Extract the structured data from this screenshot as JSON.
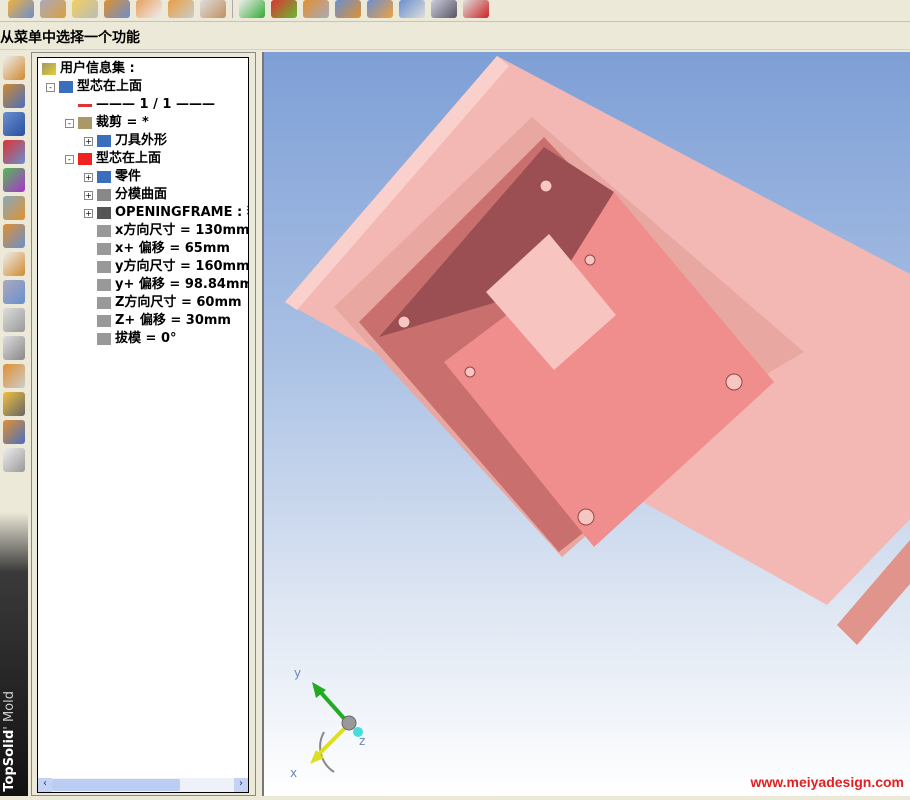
{
  "prompt": "从菜单中选择一个功能",
  "brand": {
    "name": "TopSolid",
    "suffix": "' Mold"
  },
  "tree": {
    "root": "用户信息集 :",
    "items": [
      {
        "label": "型芯在上面",
        "level": 1,
        "expander": "-"
      },
      {
        "label": "——— 1 / 1 ———",
        "level": 2,
        "expander": ""
      },
      {
        "label": "裁剪 = *",
        "level": 2,
        "expander": "-"
      },
      {
        "label": "刀具外形",
        "level": 3,
        "expander": "+"
      },
      {
        "label": "型芯在上面",
        "level": 2,
        "expander": "-"
      },
      {
        "label": "零件",
        "level": 3,
        "expander": "+"
      },
      {
        "label": "分模曲面",
        "level": 3,
        "expander": "+"
      },
      {
        "label": "OPENINGFRAME : 套",
        "level": 3,
        "expander": "+"
      },
      {
        "label": "x方向尺寸 = 130mm",
        "level": 3,
        "expander": ""
      },
      {
        "label": "x+ 偏移 = 65mm",
        "level": 3,
        "expander": ""
      },
      {
        "label": "y方向尺寸 = 160mm",
        "level": 3,
        "expander": ""
      },
      {
        "label": "y+ 偏移 = 98.84mm",
        "level": 3,
        "expander": ""
      },
      {
        "label": "Z方向尺寸 = 60mm",
        "level": 3,
        "expander": ""
      },
      {
        "label": "Z+ 偏移 = 30mm",
        "level": 3,
        "expander": ""
      },
      {
        "label": "拔模 = 0°",
        "level": 3,
        "expander": ""
      }
    ]
  },
  "axes": {
    "x": "x",
    "y": "y",
    "z": "z"
  },
  "watermark": "www.meiyadesign.com"
}
